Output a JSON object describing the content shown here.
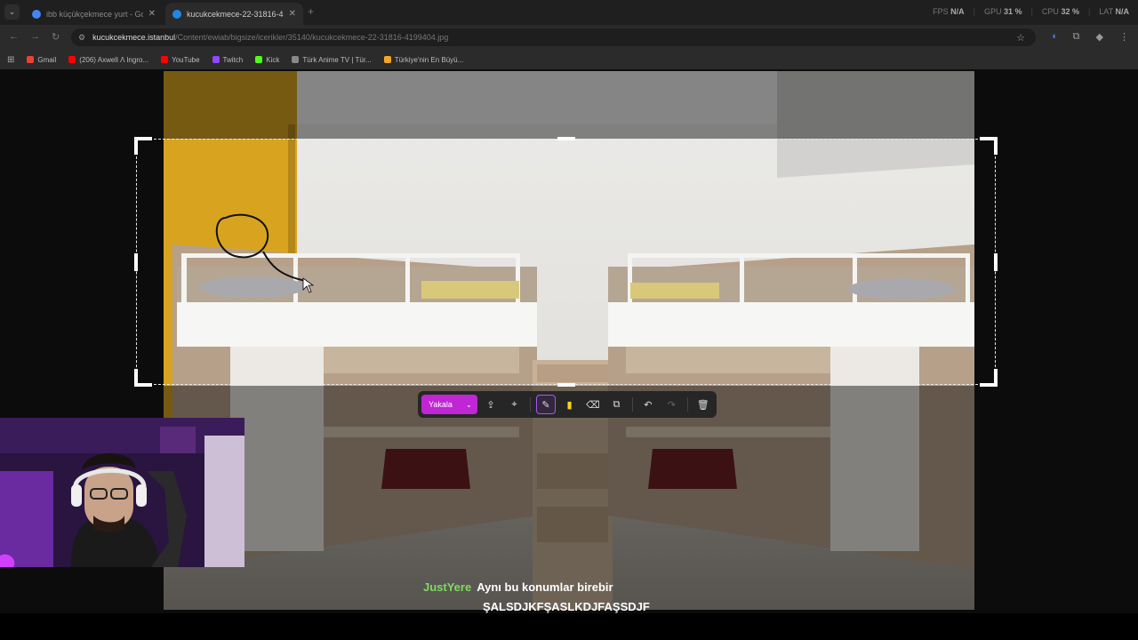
{
  "browser": {
    "tabs": [
      {
        "title": "ibb küçükçekmece yurt - Goo..."
      },
      {
        "title": "kucukcekmece-22-31816-4199..."
      }
    ],
    "perf": [
      {
        "label": "FPS",
        "value": "N/A"
      },
      {
        "label": "GPU",
        "value": "31 %"
      },
      {
        "label": "CPU",
        "value": "32 %"
      },
      {
        "label": "LAT",
        "value": "N/A"
      }
    ],
    "url_host": "kucukcekmece.istanbul",
    "url_path": "/Content/ewiab/bigsize/icerikler/35140/kucukcekmece-22-31816-4199404.jpg",
    "bookmarks": [
      {
        "label": "Gmail",
        "color": "#ea4335"
      },
      {
        "label": "(206) Axwell Λ Ingro...",
        "color": "#ff0000"
      },
      {
        "label": "YouTube",
        "color": "#ff0000"
      },
      {
        "label": "Twitch",
        "color": "#9146ff"
      },
      {
        "label": "Kick",
        "color": "#53fc18"
      },
      {
        "label": "Türk Anime TV | Tür...",
        "color": "#888888"
      },
      {
        "label": "Türkiye'nin En Büyü...",
        "color": "#f5a623"
      }
    ]
  },
  "snip_toolbar": {
    "capture_label": "Yakala"
  },
  "chat": {
    "username": "JustYere",
    "line1": "Aynı bu konumlar birebir",
    "line2": "ŞALSDJKFŞASLKDJFAŞSDJF"
  }
}
